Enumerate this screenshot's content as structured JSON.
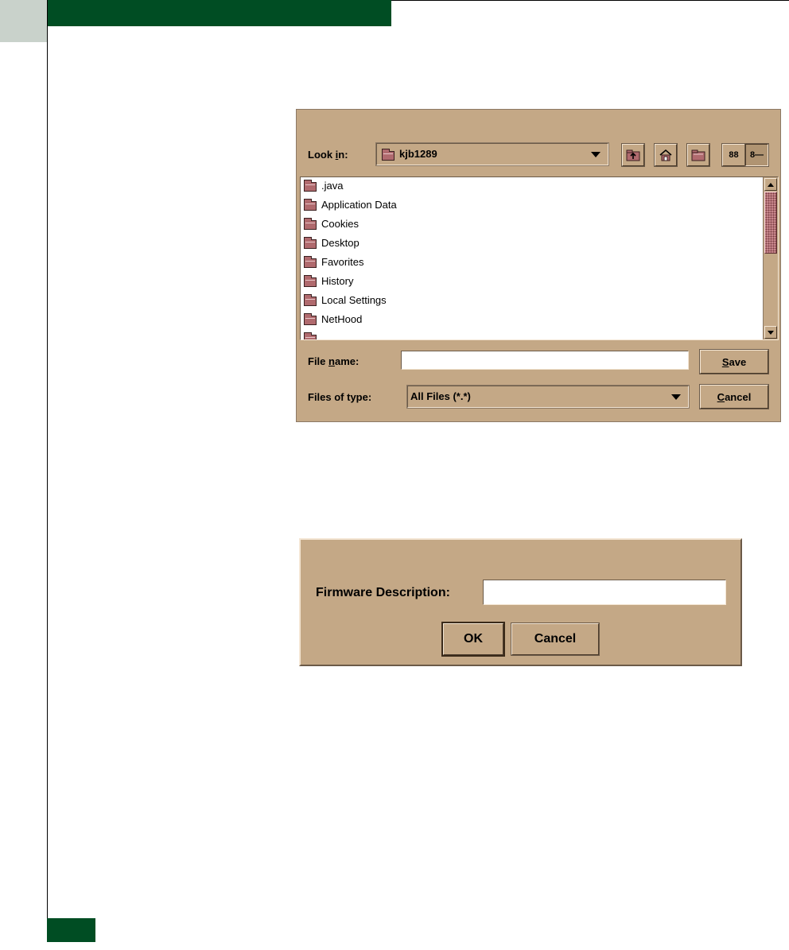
{
  "save_dialog": {
    "look_in_label_pre": "Look ",
    "look_in_label_key": "i",
    "look_in_label_post": "n:",
    "look_in_value": "kjb1289",
    "files": [
      ".java",
      "Application Data",
      "Cookies",
      "Desktop",
      "Favorites",
      "History",
      "Local Settings",
      "NetHood"
    ],
    "file_name_label_pre": "File ",
    "file_name_label_key": "n",
    "file_name_label_post": "ame:",
    "file_name_value": "",
    "files_of_type_label": "Files of type:",
    "files_of_type_value": "All Files (*.*)",
    "save_key": "S",
    "save_rest": "ave",
    "cancel_key": "C",
    "cancel_rest": "ancel",
    "view_list_glyph": "88",
    "view_details_glyph": "8—"
  },
  "firmware_dialog": {
    "label": "Firmware Description:",
    "input_value": "",
    "ok_label": "OK",
    "cancel_label": "Cancel"
  }
}
